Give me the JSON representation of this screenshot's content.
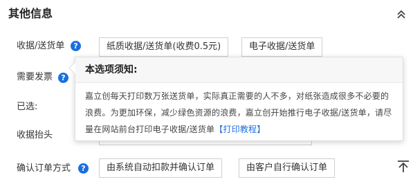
{
  "section": {
    "title": "其他信息",
    "collapse_icon": "double-chevron-up-icon"
  },
  "receipt": {
    "label": "收据/送货单",
    "help_icon": "question-circle-icon",
    "help_glyph": "?",
    "options": [
      {
        "label": "纸质收据/送货单(收费0.5元)"
      },
      {
        "label": "电子收据/送货单"
      }
    ]
  },
  "invoice": {
    "label": "需要发票",
    "help_icon": "question-circle-icon",
    "help_glyph": "?"
  },
  "selected": {
    "label": "已选:"
  },
  "receipt_header": {
    "label": "收据抬头"
  },
  "confirm": {
    "label": "确认订单方式",
    "help_icon": "question-circle-icon",
    "help_glyph": "?",
    "options": [
      {
        "label": "由系统自动扣款并确认订单"
      },
      {
        "label": "由客户自行确认订单"
      }
    ]
  },
  "tooltip": {
    "title": "本选项须知:",
    "body_text": "嘉立创每天打印数万张送货单，实际真正需要的人不多，对纸张造成很多不必要的浪费。为更加环保，减少绿色资源的浪费，嘉立创开始推行电子收据/送货单，请尽量在网站前台打印电子收据/送货单",
    "link_text": "【打印教程】"
  },
  "scroll_top_icon": "scroll-to-top-icon",
  "colors": {
    "accent": "#1b6fe0",
    "border": "#cfcfcf",
    "text": "#333333"
  }
}
